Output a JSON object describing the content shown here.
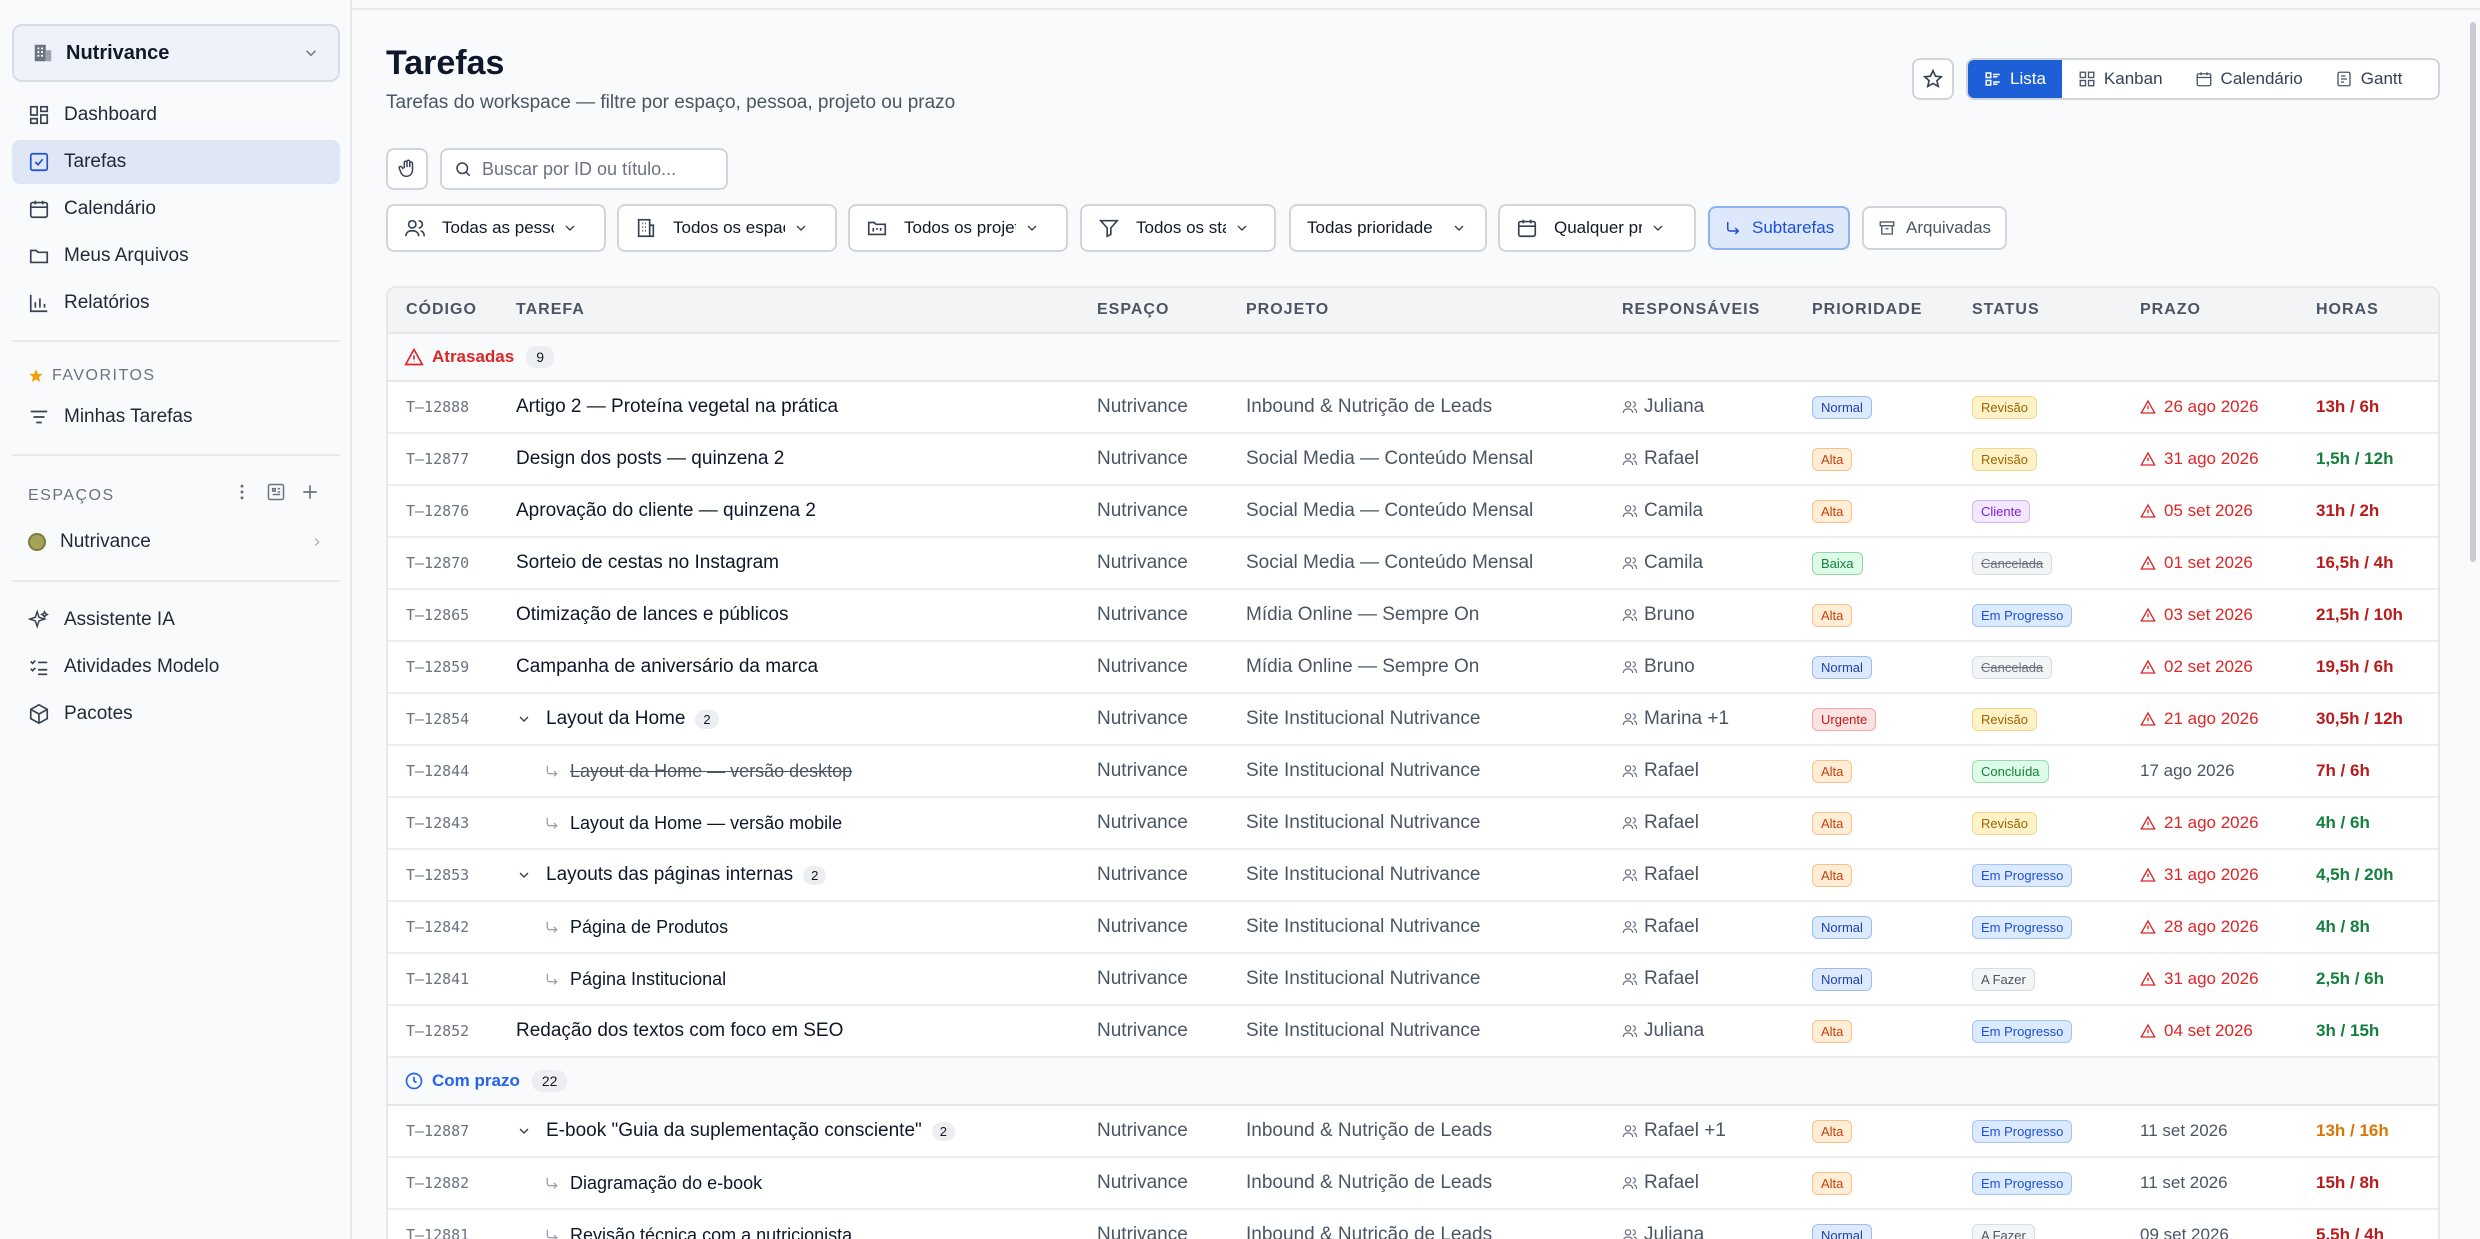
{
  "sidebar": {
    "workspace": "Nutrivance",
    "nav": [
      {
        "label": "Dashboard",
        "icon": "grid-icon"
      },
      {
        "label": "Tarefas",
        "icon": "check-square-icon"
      },
      {
        "label": "Calendário",
        "icon": "calendar-icon"
      },
      {
        "label": "Meus Arquivos",
        "icon": "folder-icon"
      },
      {
        "label": "Relatórios",
        "icon": "bar-chart-icon"
      }
    ],
    "favorites_title": "FAVORITOS",
    "favorites": [
      {
        "label": "Minhas Tarefas"
      }
    ],
    "spaces_title": "ESPAÇOS",
    "spaces": [
      {
        "label": "Nutrivance"
      }
    ],
    "tools": [
      {
        "label": "Assistente IA"
      },
      {
        "label": "Atividades Modelo"
      },
      {
        "label": "Pacotes"
      }
    ]
  },
  "header": {
    "title": "Tarefas",
    "subtitle": "Tarefas do workspace — filtre por espaço, pessoa, projeto ou prazo",
    "views": [
      "Lista",
      "Kanban",
      "Calendário",
      "Gantt"
    ],
    "active_view": "Lista"
  },
  "search": {
    "placeholder": "Buscar por ID ou título..."
  },
  "filters": {
    "people": "Todas as pessoas",
    "spaces": "Todos os espaços",
    "projects": "Todos os projetos",
    "status": "Todos os status",
    "priority": "Todas prioridade",
    "due": "Qualquer prazo",
    "subtasks": "Subtarefas",
    "archived": "Arquivadas"
  },
  "table": {
    "columns": [
      "CÓDIGO",
      "TAREFA",
      "ESPAÇO",
      "PROJETO",
      "RESPONSÁVEIS",
      "PRIORIDADE",
      "STATUS",
      "PRAZO",
      "HORAS"
    ],
    "groups": [
      {
        "label": "Atrasadas",
        "count": "9",
        "color": "#dc2626"
      },
      {
        "label": "Com prazo",
        "count": "22",
        "color": "#2563eb"
      }
    ],
    "rows": [
      {
        "code": "T–12888",
        "task": "Artigo 2 — Proteína vegetal na prática",
        "space": "Nutrivance",
        "project": "Inbound & Nutrição de Leads",
        "resp": "Juliana",
        "prio": "Normal",
        "status": "Revisão",
        "due": "26 ago 2026",
        "hours": "13h / 6h"
      },
      {
        "code": "T–12877",
        "task": "Design dos posts — quinzena 2",
        "space": "Nutrivance",
        "project": "Social Media — Conteúdo Mensal",
        "resp": "Rafael",
        "prio": "Alta",
        "status": "Revisão",
        "due": "31 ago 2026",
        "hours": "1,5h / 12h"
      },
      {
        "code": "T–12876",
        "task": "Aprovação do cliente — quinzena 2",
        "space": "Nutrivance",
        "project": "Social Media — Conteúdo Mensal",
        "resp": "Camila",
        "prio": "Alta",
        "status": "Cliente",
        "due": "05 set 2026",
        "hours": "31h / 2h"
      },
      {
        "code": "T–12870",
        "task": "Sorteio de cestas no Instagram",
        "space": "Nutrivance",
        "project": "Social Media — Conteúdo Mensal",
        "resp": "Camila",
        "prio": "Baixa",
        "status": "Cancelada",
        "due": "01 set 2026",
        "hours": "16,5h / 4h"
      },
      {
        "code": "T–12865",
        "task": "Otimização de lances e públicos",
        "space": "Nutrivance",
        "project": "Mídia Online — Sempre On",
        "resp": "Bruno",
        "prio": "Alta",
        "status": "Em Progresso",
        "due": "03 set 2026",
        "hours": "21,5h / 10h"
      },
      {
        "code": "T–12859",
        "task": "Campanha de aniversário da marca",
        "space": "Nutrivance",
        "project": "Mídia Online — Sempre On",
        "resp": "Bruno",
        "prio": "Normal",
        "status": "Cancelada",
        "due": "02 set 2026",
        "hours": "19,5h / 6h"
      },
      {
        "code": "T–12854",
        "task": "Layout da Home",
        "sub_count": "2",
        "space": "Nutrivance",
        "project": "Site Institucional Nutrivance",
        "resp": "Marina +1",
        "prio": "Urgente",
        "status": "Revisão",
        "due": "21 ago 2026",
        "hours": "30,5h / 12h"
      },
      {
        "code": "T–12844",
        "task": "Layout da Home — versão desktop",
        "space": "Nutrivance",
        "project": "Site Institucional Nutrivance",
        "resp": "Rafael",
        "prio": "Alta",
        "status": "Concluída",
        "due": "17 ago 2026",
        "hours": "7h / 6h"
      },
      {
        "code": "T–12843",
        "task": "Layout da Home — versão mobile",
        "space": "Nutrivance",
        "project": "Site Institucional Nutrivance",
        "resp": "Rafael",
        "prio": "Alta",
        "status": "Revisão",
        "due": "21 ago 2026",
        "hours": "4h / 6h"
      },
      {
        "code": "T–12853",
        "task": "Layouts das páginas internas",
        "sub_count": "2",
        "space": "Nutrivance",
        "project": "Site Institucional Nutrivance",
        "resp": "Rafael",
        "prio": "Alta",
        "status": "Em Progresso",
        "due": "31 ago 2026",
        "hours": "4,5h / 20h"
      },
      {
        "code": "T–12842",
        "task": "Página de Produtos",
        "space": "Nutrivance",
        "project": "Site Institucional Nutrivance",
        "resp": "Rafael",
        "prio": "Normal",
        "status": "Em Progresso",
        "due": "28 ago 2026",
        "hours": "4h / 8h"
      },
      {
        "code": "T–12841",
        "task": "Página Institucional",
        "space": "Nutrivance",
        "project": "Site Institucional Nutrivance",
        "resp": "Rafael",
        "prio": "Normal",
        "status": "A Fazer",
        "due": "31 ago 2026",
        "hours": "2,5h / 6h"
      },
      {
        "code": "T–12852",
        "task": "Redação dos textos com foco em SEO",
        "space": "Nutrivance",
        "project": "Site Institucional Nutrivance",
        "resp": "Juliana",
        "prio": "Alta",
        "status": "Em Progresso",
        "due": "04 set 2026",
        "hours": "3h / 15h"
      },
      {
        "code": "T–12887",
        "task": "E-book \"Guia da suplementação consciente\"",
        "sub_count": "2",
        "space": "Nutrivance",
        "project": "Inbound & Nutrição de Leads",
        "resp": "Rafael +1",
        "prio": "Alta",
        "status": "Em Progresso",
        "due": "11 set 2026",
        "hours": "13h / 16h"
      },
      {
        "code": "T–12882",
        "task": "Diagramação do e-book",
        "space": "Nutrivance",
        "project": "Inbound & Nutrição de Leads",
        "resp": "Rafael",
        "prio": "Alta",
        "status": "Em Progresso",
        "due": "11 set 2026",
        "hours": "15h / 8h"
      },
      {
        "code": "T–12881",
        "task": "Revisão técnica com a nutricionista",
        "space": "Nutrivance",
        "project": "Inbound & Nutrição de Leads",
        "resp": "Juliana",
        "prio": "Normal",
        "status": "A Fazer",
        "due": "09 set 2026",
        "hours": "5,5h / 4h"
      }
    ]
  }
}
